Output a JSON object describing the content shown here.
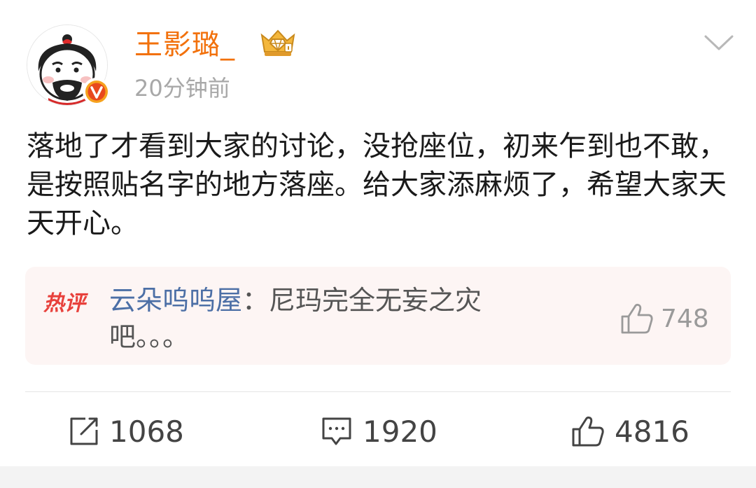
{
  "post": {
    "username": "王影璐_",
    "timestamp": "20分钟前",
    "text": "落地了才看到大家的讨论，没抢座位，初来乍到也不敢，是按照贴名字的地方落座。给大家添麻烦了，希望大家天天开心。",
    "verified_icon": "yellow-v-verified",
    "vip_icon": "crown-diamond-vip"
  },
  "hot_comment": {
    "tag": "热评",
    "user": "云朵呜呜屋",
    "separator": "：",
    "text": "尼玛完全无妄之灾吧。。。",
    "likes": "748"
  },
  "actions": {
    "repost_count": "1068",
    "comment_count": "1920",
    "like_count": "4816"
  },
  "colors": {
    "username": "#f2710c",
    "comment_user": "#4c6fa6",
    "hot_tag": "#e8413c",
    "hot_bg": "#fdf5f4"
  }
}
